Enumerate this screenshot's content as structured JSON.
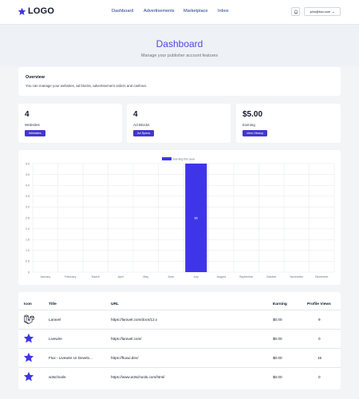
{
  "header": {
    "logo_text": "LOGO",
    "nav": [
      "Dashboard",
      "Advertisements",
      "Marketplace",
      "Inbox"
    ],
    "user_email": "john@box.com",
    "user_caret": "⌄"
  },
  "hero": {
    "title": "Dashboard",
    "subtitle": "Manage your publisher account features"
  },
  "overview": {
    "heading": "Overview",
    "description": "You can manage your websites, ad blocks, advertisement orders and cashout."
  },
  "stats": [
    {
      "value": "4",
      "label": "Websites",
      "button": "Websites"
    },
    {
      "value": "4",
      "label": "Ad Blocks",
      "button": "Ad Specs"
    },
    {
      "value": "$5.00",
      "label": "Earning",
      "button": "View History"
    }
  ],
  "colors": {
    "accent": "#4f46e5",
    "button": "#4338ca",
    "bar": "#3f35e8"
  },
  "chart_data": {
    "type": "bar",
    "categories": [
      "January",
      "February",
      "March",
      "April",
      "May",
      "June",
      "July",
      "August",
      "September",
      "October",
      "November",
      "December"
    ],
    "series": [
      {
        "name": "Earning this year",
        "values": [
          0,
          0,
          0,
          0,
          0,
          0,
          5,
          0,
          0,
          0,
          0,
          0
        ],
        "labels": [
          "",
          "",
          "",
          "",
          "",
          "",
          "$5",
          "",
          "",
          "",
          "",
          ""
        ]
      }
    ],
    "ylim": [
      0,
      5.0
    ],
    "yticks": [
      "0",
      "0.5",
      "1.0",
      "1.5",
      "2.0",
      "2.5",
      "3.0",
      "3.5",
      "4.0",
      "4.5",
      "5.0"
    ],
    "legend": "top-center",
    "grid": true
  },
  "table": {
    "headers": [
      "Icon",
      "Title",
      "URL",
      "Earning",
      "Profile Views"
    ],
    "rows": [
      {
        "icon": "laravel-icon",
        "title": "Laravel",
        "url": "https://laravel.com/docs/12.x",
        "earning": "$0.00",
        "views": "9"
      },
      {
        "icon": "star-icon",
        "title": "Livewire",
        "url": "https://laravel.com/",
        "earning": "$0.00",
        "views": "0"
      },
      {
        "icon": "star-icon",
        "title": "Flux - Livewire UI Develo...",
        "url": "https://fluxui.dev/",
        "earning": "$0.00",
        "views": "15"
      },
      {
        "icon": "star-icon",
        "title": "w3schools",
        "url": "https://www.w3schools.com/html/",
        "earning": "$0.00",
        "views": "0"
      }
    ]
  }
}
